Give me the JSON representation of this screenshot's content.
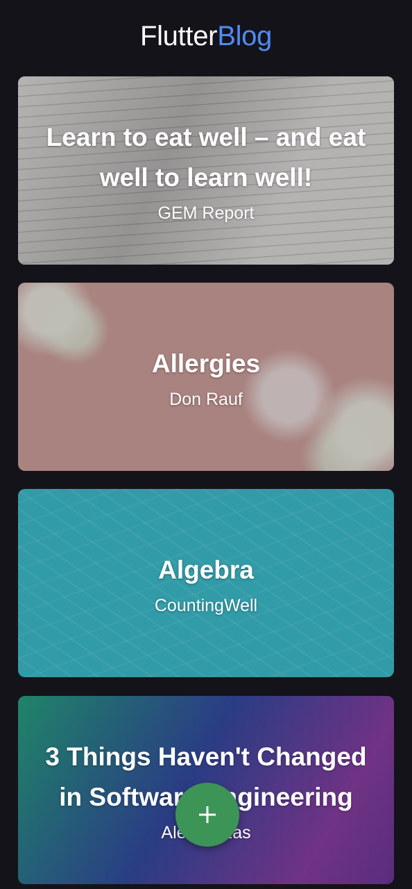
{
  "app_bar": {
    "title_part1": "Flutter",
    "title_part2": "Blog",
    "title_part2_color": "#4d8cf5"
  },
  "posts": [
    {
      "title": "Learn to eat well – and eat well to learn well!",
      "author": "GEM Report",
      "image": "notebook-writing"
    },
    {
      "title": "Allergies",
      "author": "Don Rauf",
      "image": "medicine-pink"
    },
    {
      "title": "Algebra",
      "author": "CountingWell",
      "image": "math-chalkboard"
    },
    {
      "title": "3 Things Haven't Changed in Software Engineering",
      "author": "Alex Mezas",
      "image": "colorful-blocks"
    }
  ],
  "fab": {
    "icon": "plus-icon",
    "color": "#3c9456"
  }
}
